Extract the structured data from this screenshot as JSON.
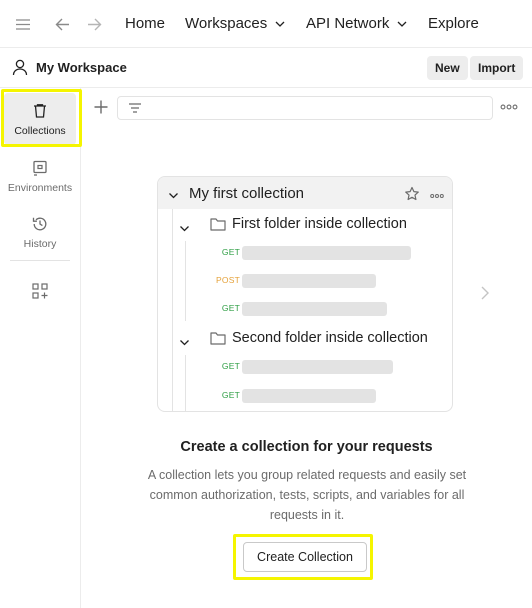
{
  "topnav": {
    "menu_icon": "hamburger-menu-icon",
    "back_icon": "arrow-left-icon",
    "forward_icon": "arrow-right-icon",
    "items": [
      {
        "label": "Home"
      },
      {
        "label": "Workspaces",
        "icon": "chevron-down-icon"
      },
      {
        "label": "API Network",
        "icon": "chevron-down-icon"
      },
      {
        "label": "Explore"
      }
    ]
  },
  "workspace": {
    "icon": "user-icon",
    "name": "My Workspace",
    "new_label": "New",
    "import_label": "Import"
  },
  "sidebar": {
    "items": [
      {
        "label": "Collections",
        "icon": "trash-can-collections-icon",
        "active": true
      },
      {
        "label": "Environments",
        "icon": "environment-icon"
      },
      {
        "label": "History",
        "icon": "history-clock-icon"
      }
    ],
    "extra_icon": "apps-grid-add-icon",
    "highlight_color": "#f5f500"
  },
  "toolbar": {
    "add_icon": "plus-icon",
    "filter_icon": "filter-lines-icon",
    "filter_value": "",
    "more_icon": "more-horizontal-icon"
  },
  "preview": {
    "collection_title": "My first collection",
    "star_icon": "star-icon",
    "more_icon": "more-horizontal-icon",
    "folders": [
      {
        "label": "First folder inside collection",
        "requests": [
          {
            "method": "GET"
          },
          {
            "method": "POST"
          },
          {
            "method": "GET"
          }
        ]
      },
      {
        "label": "Second folder inside collection",
        "requests": [
          {
            "method": "GET"
          },
          {
            "method": "GET"
          }
        ]
      }
    ],
    "method_colors": {
      "GET": "#2e9e44",
      "POST": "#e5a23b"
    },
    "next_icon": "chevron-right-icon"
  },
  "empty_state": {
    "title": "Create a collection for your requests",
    "description": "A collection lets you group related requests and easily set common authorization, tests, scripts, and variables for all requests in it.",
    "button_label": "Create Collection"
  }
}
